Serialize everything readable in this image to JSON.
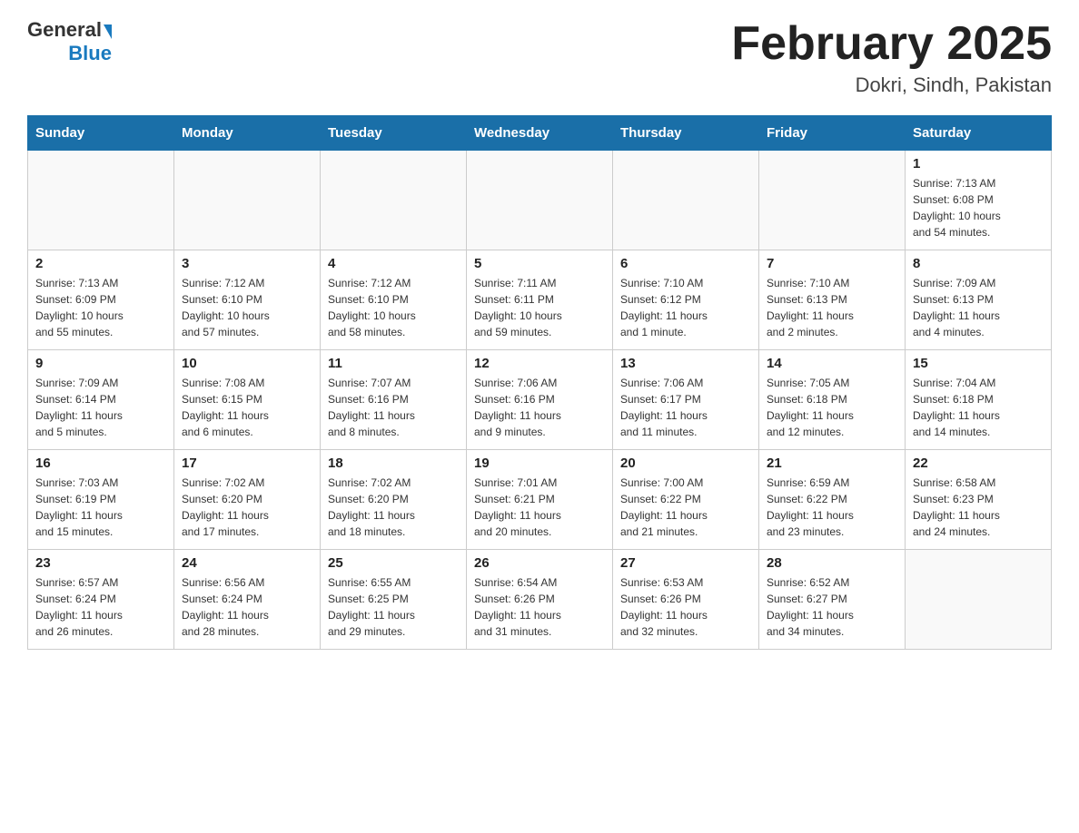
{
  "header": {
    "logo_general": "General",
    "logo_blue": "Blue",
    "title": "February 2025",
    "subtitle": "Dokri, Sindh, Pakistan"
  },
  "days_of_week": [
    "Sunday",
    "Monday",
    "Tuesday",
    "Wednesday",
    "Thursday",
    "Friday",
    "Saturday"
  ],
  "weeks": [
    [
      {
        "day": "",
        "info": ""
      },
      {
        "day": "",
        "info": ""
      },
      {
        "day": "",
        "info": ""
      },
      {
        "day": "",
        "info": ""
      },
      {
        "day": "",
        "info": ""
      },
      {
        "day": "",
        "info": ""
      },
      {
        "day": "1",
        "info": "Sunrise: 7:13 AM\nSunset: 6:08 PM\nDaylight: 10 hours\nand 54 minutes."
      }
    ],
    [
      {
        "day": "2",
        "info": "Sunrise: 7:13 AM\nSunset: 6:09 PM\nDaylight: 10 hours\nand 55 minutes."
      },
      {
        "day": "3",
        "info": "Sunrise: 7:12 AM\nSunset: 6:10 PM\nDaylight: 10 hours\nand 57 minutes."
      },
      {
        "day": "4",
        "info": "Sunrise: 7:12 AM\nSunset: 6:10 PM\nDaylight: 10 hours\nand 58 minutes."
      },
      {
        "day": "5",
        "info": "Sunrise: 7:11 AM\nSunset: 6:11 PM\nDaylight: 10 hours\nand 59 minutes."
      },
      {
        "day": "6",
        "info": "Sunrise: 7:10 AM\nSunset: 6:12 PM\nDaylight: 11 hours\nand 1 minute."
      },
      {
        "day": "7",
        "info": "Sunrise: 7:10 AM\nSunset: 6:13 PM\nDaylight: 11 hours\nand 2 minutes."
      },
      {
        "day": "8",
        "info": "Sunrise: 7:09 AM\nSunset: 6:13 PM\nDaylight: 11 hours\nand 4 minutes."
      }
    ],
    [
      {
        "day": "9",
        "info": "Sunrise: 7:09 AM\nSunset: 6:14 PM\nDaylight: 11 hours\nand 5 minutes."
      },
      {
        "day": "10",
        "info": "Sunrise: 7:08 AM\nSunset: 6:15 PM\nDaylight: 11 hours\nand 6 minutes."
      },
      {
        "day": "11",
        "info": "Sunrise: 7:07 AM\nSunset: 6:16 PM\nDaylight: 11 hours\nand 8 minutes."
      },
      {
        "day": "12",
        "info": "Sunrise: 7:06 AM\nSunset: 6:16 PM\nDaylight: 11 hours\nand 9 minutes."
      },
      {
        "day": "13",
        "info": "Sunrise: 7:06 AM\nSunset: 6:17 PM\nDaylight: 11 hours\nand 11 minutes."
      },
      {
        "day": "14",
        "info": "Sunrise: 7:05 AM\nSunset: 6:18 PM\nDaylight: 11 hours\nand 12 minutes."
      },
      {
        "day": "15",
        "info": "Sunrise: 7:04 AM\nSunset: 6:18 PM\nDaylight: 11 hours\nand 14 minutes."
      }
    ],
    [
      {
        "day": "16",
        "info": "Sunrise: 7:03 AM\nSunset: 6:19 PM\nDaylight: 11 hours\nand 15 minutes."
      },
      {
        "day": "17",
        "info": "Sunrise: 7:02 AM\nSunset: 6:20 PM\nDaylight: 11 hours\nand 17 minutes."
      },
      {
        "day": "18",
        "info": "Sunrise: 7:02 AM\nSunset: 6:20 PM\nDaylight: 11 hours\nand 18 minutes."
      },
      {
        "day": "19",
        "info": "Sunrise: 7:01 AM\nSunset: 6:21 PM\nDaylight: 11 hours\nand 20 minutes."
      },
      {
        "day": "20",
        "info": "Sunrise: 7:00 AM\nSunset: 6:22 PM\nDaylight: 11 hours\nand 21 minutes."
      },
      {
        "day": "21",
        "info": "Sunrise: 6:59 AM\nSunset: 6:22 PM\nDaylight: 11 hours\nand 23 minutes."
      },
      {
        "day": "22",
        "info": "Sunrise: 6:58 AM\nSunset: 6:23 PM\nDaylight: 11 hours\nand 24 minutes."
      }
    ],
    [
      {
        "day": "23",
        "info": "Sunrise: 6:57 AM\nSunset: 6:24 PM\nDaylight: 11 hours\nand 26 minutes."
      },
      {
        "day": "24",
        "info": "Sunrise: 6:56 AM\nSunset: 6:24 PM\nDaylight: 11 hours\nand 28 minutes."
      },
      {
        "day": "25",
        "info": "Sunrise: 6:55 AM\nSunset: 6:25 PM\nDaylight: 11 hours\nand 29 minutes."
      },
      {
        "day": "26",
        "info": "Sunrise: 6:54 AM\nSunset: 6:26 PM\nDaylight: 11 hours\nand 31 minutes."
      },
      {
        "day": "27",
        "info": "Sunrise: 6:53 AM\nSunset: 6:26 PM\nDaylight: 11 hours\nand 32 minutes."
      },
      {
        "day": "28",
        "info": "Sunrise: 6:52 AM\nSunset: 6:27 PM\nDaylight: 11 hours\nand 34 minutes."
      },
      {
        "day": "",
        "info": ""
      }
    ]
  ]
}
